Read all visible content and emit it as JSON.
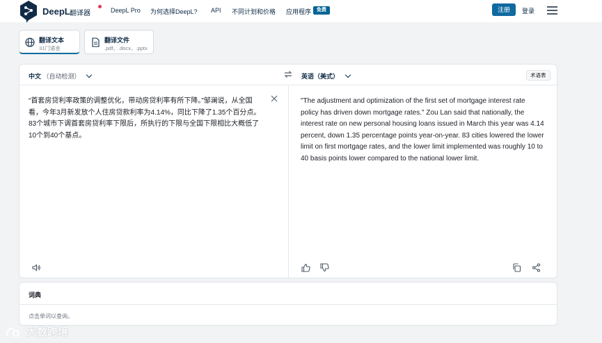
{
  "nav": {
    "brand": "DeepL",
    "brand_sub": "翻译器",
    "items": [
      "DeepL Pro",
      "为何选择DeepL?",
      "API",
      "不同计划和价格",
      "应用程序"
    ],
    "apps_badge": "免费",
    "register": "注册",
    "login": "登录"
  },
  "tabs": [
    {
      "title": "翻译文本",
      "sub": "31门语言",
      "icon": "globe-icon"
    },
    {
      "title": "翻译文件",
      "sub": ".pdf、.docx、.pptx",
      "icon": "document-icon"
    }
  ],
  "translator": {
    "source_lang": "中文",
    "source_detect": "（自动检测）",
    "target_lang": "英语（美式）",
    "glossary": "术语表",
    "source_text": "“首套房贷利率政策的调整优化，带动房贷利率有所下降。”邹澜说，从全国看，今年3月新发放个人住房贷款利率为4.14%，同比下降了1.35个百分点。83个城市下调首套房贷利率下限后，所执行的下限与全国下限相比大概低了10个到40个基点。",
    "target_text": "\"The adjustment and optimization of the first set of mortgage interest rate policy has driven down mortgage rates.\" Zou Lan said that nationally, the interest rate on new personal housing loans issued in March this year was 4.14 percent, down 1.35 percentage points year-on-year. 83 cities lowered the lower limit on first mortgage rates, and the lower limit implemented was roughly 10 to 40 basis points lower compared to the national lower limit."
  },
  "dictionary": {
    "title": "词典",
    "hint": "点击单词以查询。"
  },
  "watermark": "大数跨境",
  "colors": {
    "accent": "#0f6aa0",
    "brand": "#0f2b46",
    "badge": "#006494"
  }
}
